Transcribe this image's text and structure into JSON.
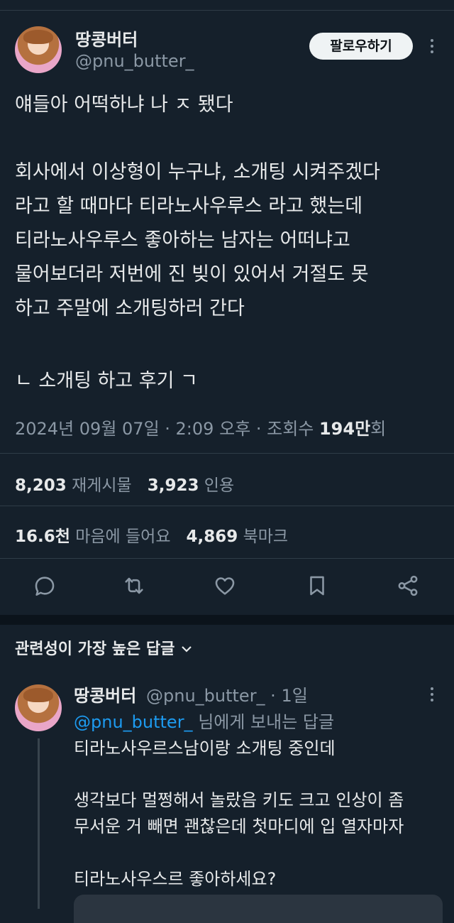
{
  "author": {
    "name": "땅콩버터",
    "handle": "@pnu_butter_",
    "follow_label": "팔로우하기"
  },
  "tweet": {
    "para1": "얘들아 어떡하냐 나 ㅈ 됐다",
    "para2": "회사에서 이상형이 누구냐, 소개팅 시켜주겠다\n라고 할 때마다 티라노사우루스 라고 했는데\n티라노사우루스 좋아하는 남자는 어떠냐고\n물어보더라 저번에 진 빚이 있어서 거절도 못\n하고 주말에 소개팅하러 간다",
    "para3": "ㄴ 소개팅 하고 후기 ㄱ"
  },
  "meta": {
    "datetime": "2024년 09월 07일 · 2:09 오후 · 조회수 ",
    "views": "194만",
    "views_suffix": "회"
  },
  "stats": {
    "retweets": "8,203",
    "retweets_label": "재게시물",
    "quotes": "3,923",
    "quotes_label": "인용",
    "likes": "16.6천",
    "likes_label": "마음에 들어요",
    "bookmarks": "4,869",
    "bookmarks_label": "북마크"
  },
  "actions": {
    "icons": [
      "reply-icon",
      "retweet-icon",
      "like-icon",
      "bookmark-icon",
      "share-icon"
    ]
  },
  "replies": {
    "sort_label": "관련성이 가장 높은 답글",
    "reply": {
      "name": "땅콩버터",
      "handle_time": "@pnu_butter_ · 1일",
      "mention": "@pnu_butter_",
      "reply_to_suffix": " 님에게 보내는 답글",
      "para1": "티라노사우르스남이랑 소개팅 중인데",
      "para2": "생각보다 멀쩡해서 놀랐음 키도 크고 인상이 좀\n무서운 거 빼면 괜찮은데 첫마디에 입 열자마자",
      "para3": "티라노사우스르 좋아하세요?"
    }
  },
  "colors": {
    "background": "#15202b",
    "text": "#e7e9ea",
    "muted": "#8b98a5",
    "link": "#1d9bf0"
  }
}
